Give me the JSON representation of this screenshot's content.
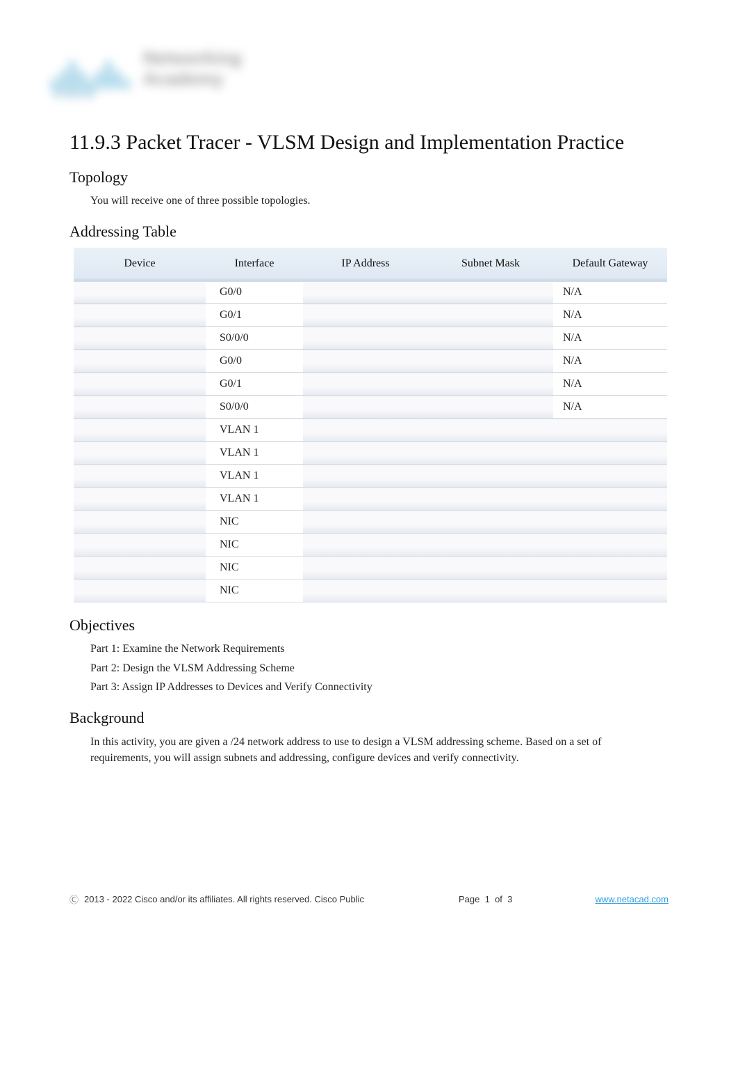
{
  "logo": {
    "brand": "cisco",
    "line1": "Networking",
    "line2": "Academy"
  },
  "title": "11.9.3 Packet Tracer - VLSM Design and Implementation Practice",
  "sections": {
    "topology": {
      "heading": "Topology",
      "text": "You will receive one of three possible topologies."
    },
    "addressing": {
      "heading": "Addressing Table",
      "columns": [
        "Device",
        "Interface",
        "IP Address",
        "Subnet Mask",
        "Default Gateway"
      ],
      "rows": [
        {
          "device": "",
          "interface": "G0/0",
          "ip": "",
          "mask": "",
          "gw": "N/A"
        },
        {
          "device": "",
          "interface": "G0/1",
          "ip": "",
          "mask": "",
          "gw": "N/A"
        },
        {
          "device": "",
          "interface": "S0/0/0",
          "ip": "",
          "mask": "",
          "gw": "N/A"
        },
        {
          "device": "",
          "interface": "G0/0",
          "ip": "",
          "mask": "",
          "gw": "N/A"
        },
        {
          "device": "",
          "interface": "G0/1",
          "ip": "",
          "mask": "",
          "gw": "N/A"
        },
        {
          "device": "",
          "interface": "S0/0/0",
          "ip": "",
          "mask": "",
          "gw": "N/A"
        },
        {
          "device": "",
          "interface": "VLAN 1",
          "ip": "",
          "mask": "",
          "gw": ""
        },
        {
          "device": "",
          "interface": "VLAN 1",
          "ip": "",
          "mask": "",
          "gw": ""
        },
        {
          "device": "",
          "interface": "VLAN 1",
          "ip": "",
          "mask": "",
          "gw": ""
        },
        {
          "device": "",
          "interface": "VLAN 1",
          "ip": "",
          "mask": "",
          "gw": ""
        },
        {
          "device": "",
          "interface": "NIC",
          "ip": "",
          "mask": "",
          "gw": ""
        },
        {
          "device": "",
          "interface": "NIC",
          "ip": "",
          "mask": "",
          "gw": ""
        },
        {
          "device": "",
          "interface": "NIC",
          "ip": "",
          "mask": "",
          "gw": ""
        },
        {
          "device": "",
          "interface": "NIC",
          "ip": "",
          "mask": "",
          "gw": ""
        }
      ]
    },
    "objectives": {
      "heading": "Objectives",
      "items": [
        "Part 1: Examine the Network Requirements",
        "Part 2: Design the VLSM Addressing Scheme",
        "Part 3: Assign IP Addresses to Devices and Verify Connectivity"
      ]
    },
    "background": {
      "heading": "Background",
      "text": "In this activity, you are given a /24 network address to use to design a VLSM addressing scheme. Based on a set of requirements, you will assign subnets and addressing, configure devices and verify connectivity."
    }
  },
  "footer": {
    "copyright_symbol": "Ⓒ",
    "copyright": "2013 - 2022 Cisco and/or its affiliates. All rights reserved. Cisco Public",
    "page_label": "Page",
    "page_current": "1",
    "page_of": "of",
    "page_total": "3",
    "link": "www.netacad.com"
  }
}
